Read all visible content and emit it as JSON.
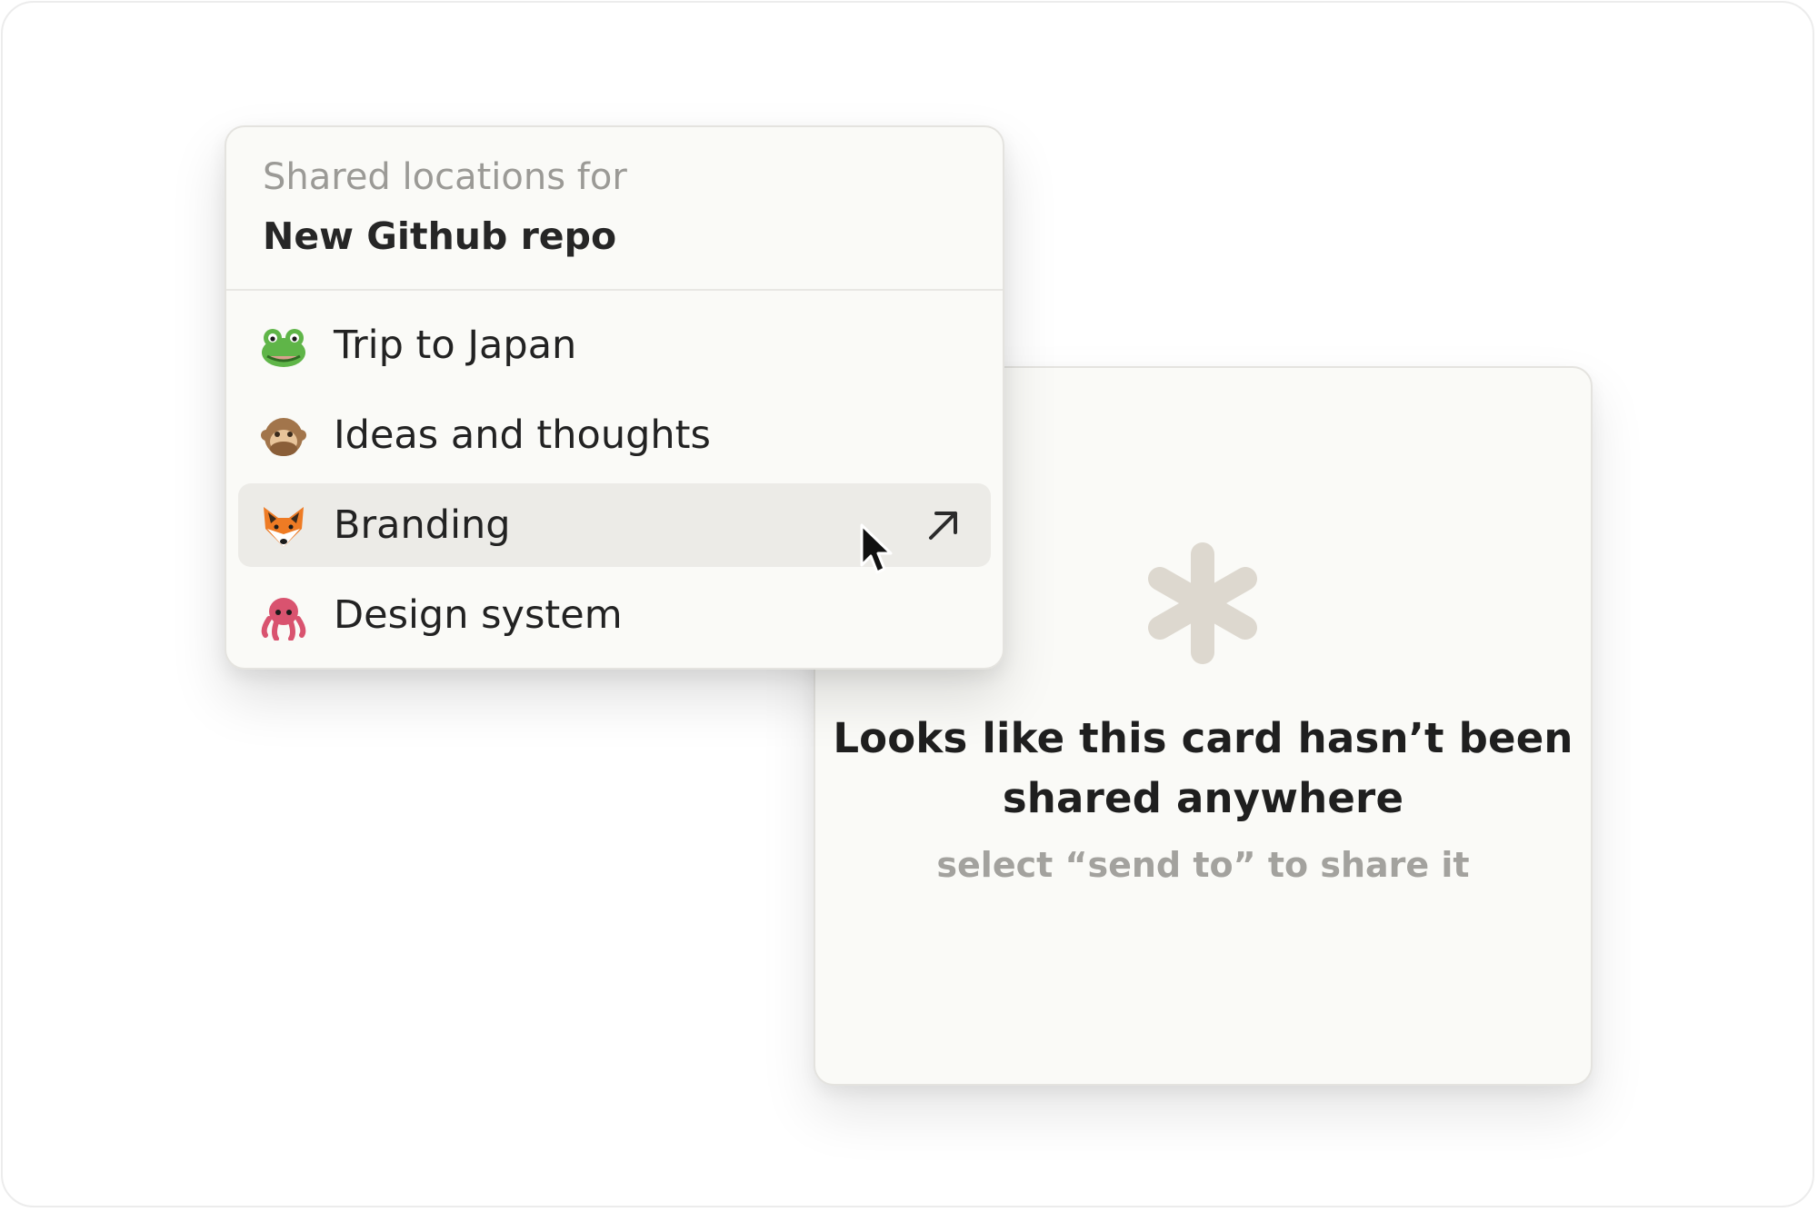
{
  "popover": {
    "header_label": "Shared locations for",
    "header_title": "New Github repo",
    "items": [
      {
        "label": "Trip to Japan",
        "icon": "frog-emoji-icon",
        "selected": false
      },
      {
        "label": "Ideas and thoughts",
        "icon": "see-no-evil-monkey-emoji-icon",
        "selected": false
      },
      {
        "label": "Branding",
        "icon": "fox-emoji-icon",
        "selected": true
      },
      {
        "label": "Design system",
        "icon": "octopus-emoji-icon",
        "selected": false
      }
    ],
    "selected_action_icon": "arrow-up-right-icon"
  },
  "empty_card": {
    "icon": "asterisk-icon",
    "title_line1": "Looks like this card hasn’t been",
    "title_line2": "shared anywhere",
    "subtitle": "select “send to” to share it"
  },
  "colors": {
    "background": "#ffffff",
    "panel": "#fafaf7",
    "selected_row": "#ecebe7",
    "muted_text": "#9b9a96",
    "asterisk": "#ddd8cf"
  }
}
